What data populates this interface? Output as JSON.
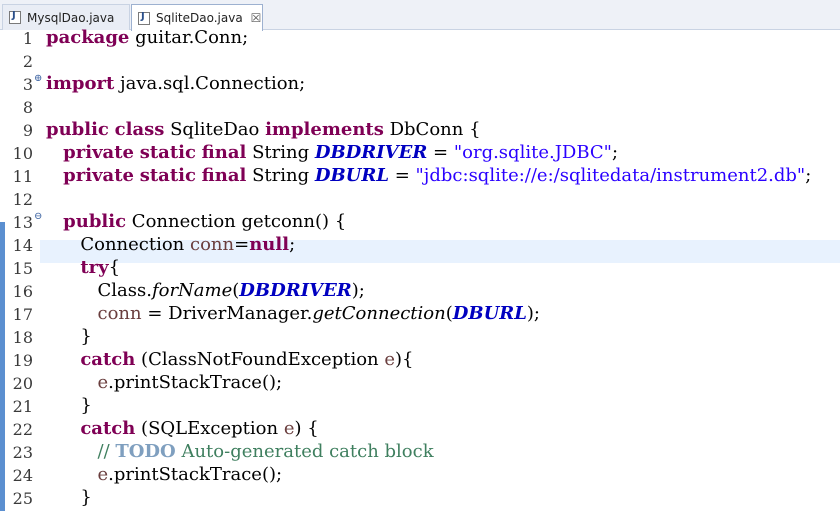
{
  "tabs": [
    {
      "label": "MysqlDao.java",
      "active": false
    },
    {
      "label": "SqliteDao.java",
      "active": true,
      "close": "☒"
    }
  ],
  "fold_markers": {
    "13": "⊖",
    "3": "⊕"
  },
  "lines": [
    {
      "n": "1",
      "segs": [
        [
          "kw",
          "package"
        ],
        [
          "p",
          " guitar.Conn;"
        ]
      ]
    },
    {
      "n": "2",
      "segs": []
    },
    {
      "n": "3",
      "segs": [
        [
          "kw",
          "import"
        ],
        [
          "p",
          " java.sql.Connection;"
        ]
      ]
    },
    {
      "n": "8",
      "segs": []
    },
    {
      "n": "9",
      "segs": [
        [
          "kw",
          "public"
        ],
        [
          "p",
          " "
        ],
        [
          "kw",
          "class"
        ],
        [
          "p",
          " SqliteDao "
        ],
        [
          "kw",
          "implements"
        ],
        [
          "p",
          " DbConn {"
        ]
      ]
    },
    {
      "n": "10",
      "segs": [
        [
          "p",
          "   "
        ],
        [
          "kw",
          "private"
        ],
        [
          "p",
          " "
        ],
        [
          "kw",
          "static"
        ],
        [
          "p",
          " "
        ],
        [
          "kw",
          "final"
        ],
        [
          "p",
          " String "
        ],
        [
          "const",
          "DBDRIVER"
        ],
        [
          "p",
          " = "
        ],
        [
          "str",
          "\"org.sqlite.JDBC\""
        ],
        [
          "p",
          ";"
        ]
      ]
    },
    {
      "n": "11",
      "segs": [
        [
          "p",
          "   "
        ],
        [
          "kw",
          "private"
        ],
        [
          "p",
          " "
        ],
        [
          "kw",
          "static"
        ],
        [
          "p",
          " "
        ],
        [
          "kw",
          "final"
        ],
        [
          "p",
          " String "
        ],
        [
          "const",
          "DBURL"
        ],
        [
          "p",
          " = "
        ],
        [
          "str",
          "\"jdbc:sqlite://e:/sqlitedata/instrument2.db\""
        ],
        [
          "p",
          ";"
        ]
      ]
    },
    {
      "n": "12",
      "segs": []
    },
    {
      "n": "13",
      "segs": [
        [
          "p",
          "   "
        ],
        [
          "kw",
          "public"
        ],
        [
          "p",
          " Connection getconn() {"
        ]
      ]
    },
    {
      "n": "14",
      "segs": [
        [
          "p",
          "      Connection "
        ],
        [
          "var",
          "conn"
        ],
        [
          "p",
          "="
        ],
        [
          "kw",
          "null"
        ],
        [
          "p",
          ";"
        ]
      ]
    },
    {
      "n": "15",
      "segs": [
        [
          "p",
          "      "
        ],
        [
          "kw",
          "try"
        ],
        [
          "p",
          "{"
        ]
      ]
    },
    {
      "n": "16",
      "segs": [
        [
          "p",
          "         Class."
        ],
        [
          "smeth",
          "forName"
        ],
        [
          "p",
          "("
        ],
        [
          "const",
          "DBDRIVER"
        ],
        [
          "p",
          ");"
        ]
      ]
    },
    {
      "n": "17",
      "segs": [
        [
          "p",
          "         "
        ],
        [
          "var",
          "conn"
        ],
        [
          "p",
          " = DriverManager."
        ],
        [
          "smeth",
          "getConnection"
        ],
        [
          "p",
          "("
        ],
        [
          "const",
          "DBURL"
        ],
        [
          "p",
          ");"
        ]
      ]
    },
    {
      "n": "18",
      "segs": [
        [
          "p",
          "      }"
        ]
      ]
    },
    {
      "n": "19",
      "segs": [
        [
          "p",
          "      "
        ],
        [
          "kw",
          "catch"
        ],
        [
          "p",
          " (ClassNotFoundException "
        ],
        [
          "var",
          "e"
        ],
        [
          "p",
          "){"
        ]
      ]
    },
    {
      "n": "20",
      "segs": [
        [
          "p",
          "         "
        ],
        [
          "var",
          "e"
        ],
        [
          "p",
          ".printStackTrace();"
        ]
      ]
    },
    {
      "n": "21",
      "segs": [
        [
          "p",
          "      }"
        ]
      ]
    },
    {
      "n": "22",
      "segs": [
        [
          "p",
          "      "
        ],
        [
          "kw",
          "catch"
        ],
        [
          "p",
          " (SQLException "
        ],
        [
          "var",
          "e"
        ],
        [
          "p",
          ") {"
        ]
      ]
    },
    {
      "n": "23",
      "segs": [
        [
          "p",
          "         "
        ],
        [
          "comment",
          "// "
        ],
        [
          "todo",
          "TODO"
        ],
        [
          "comment",
          " Auto-generated catch block"
        ]
      ]
    },
    {
      "n": "24",
      "segs": [
        [
          "p",
          "         "
        ],
        [
          "var",
          "e"
        ],
        [
          "p",
          ".printStackTrace();"
        ]
      ]
    },
    {
      "n": "25",
      "segs": [
        [
          "p",
          "      }"
        ]
      ]
    }
  ],
  "current_line": "14"
}
